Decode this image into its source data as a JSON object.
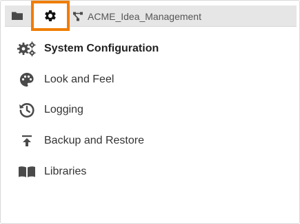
{
  "toolbar": {
    "folder_icon": "folder-icon",
    "settings_icon": "gear-icon",
    "highlight_color": "#f07d00",
    "project_icon": "branch-icon",
    "project_name": "ACME_Idea_Management"
  },
  "menu": {
    "items": [
      {
        "label": "System Configuration",
        "icon": "gears-icon",
        "active": true
      },
      {
        "label": "Look and Feel",
        "icon": "palette-icon",
        "active": false
      },
      {
        "label": "Logging",
        "icon": "history-icon",
        "active": false
      },
      {
        "label": "Backup and Restore",
        "icon": "upload-icon",
        "active": false
      },
      {
        "label": "Libraries",
        "icon": "book-icon",
        "active": false
      }
    ]
  },
  "colors": {
    "icon": "#4a4a4a",
    "toolbar_bg": "#e6e6e6",
    "text": "#333333"
  }
}
